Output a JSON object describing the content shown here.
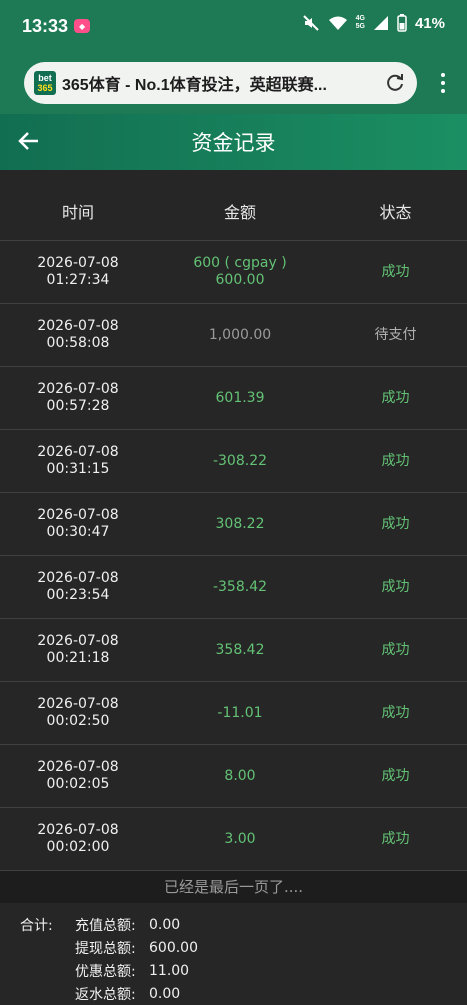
{
  "status": {
    "time": "13:33",
    "net": "4G\n5G",
    "battery": "41%"
  },
  "browser": {
    "page_title": "365体育 - No.1体育投注，英超联赛...",
    "favicon_top": "bet",
    "favicon_bottom": "365"
  },
  "header": {
    "title": "资金记录"
  },
  "table": {
    "headers": [
      "时间",
      "金额",
      "状态"
    ],
    "rows": [
      {
        "date": "2026-07-08",
        "time": "01:27:34",
        "amount": "600 ( cgpay )",
        "amount2": "600.00",
        "status": "成功"
      },
      {
        "date": "2026-07-08",
        "time": "00:58:08",
        "amount": "1,000.00",
        "status": "待支付"
      },
      {
        "date": "2026-07-08",
        "time": "00:57:28",
        "amount": "601.39",
        "status": "成功"
      },
      {
        "date": "2026-07-08",
        "time": "00:31:15",
        "amount": "-308.22",
        "status": "成功"
      },
      {
        "date": "2026-07-08",
        "time": "00:30:47",
        "amount": "308.22",
        "status": "成功"
      },
      {
        "date": "2026-07-08",
        "time": "00:23:54",
        "amount": "-358.42",
        "status": "成功"
      },
      {
        "date": "2026-07-08",
        "time": "00:21:18",
        "amount": "358.42",
        "status": "成功"
      },
      {
        "date": "2026-07-08",
        "time": "00:02:50",
        "amount": "-11.01",
        "status": "成功"
      },
      {
        "date": "2026-07-08",
        "time": "00:02:05",
        "amount": "8.00",
        "status": "成功"
      },
      {
        "date": "2026-07-08",
        "time": "00:02:00",
        "amount": "3.00",
        "status": "成功"
      }
    ]
  },
  "end_note": "已经是最后一页了....",
  "summary": {
    "label": "合计:",
    "items": [
      {
        "name": "充值总额:",
        "value": "0.00"
      },
      {
        "name": "提现总额:",
        "value": "600.00"
      },
      {
        "name": "优惠总额:",
        "value": "11.00"
      },
      {
        "name": "返水总额:",
        "value": "0.00"
      }
    ]
  }
}
